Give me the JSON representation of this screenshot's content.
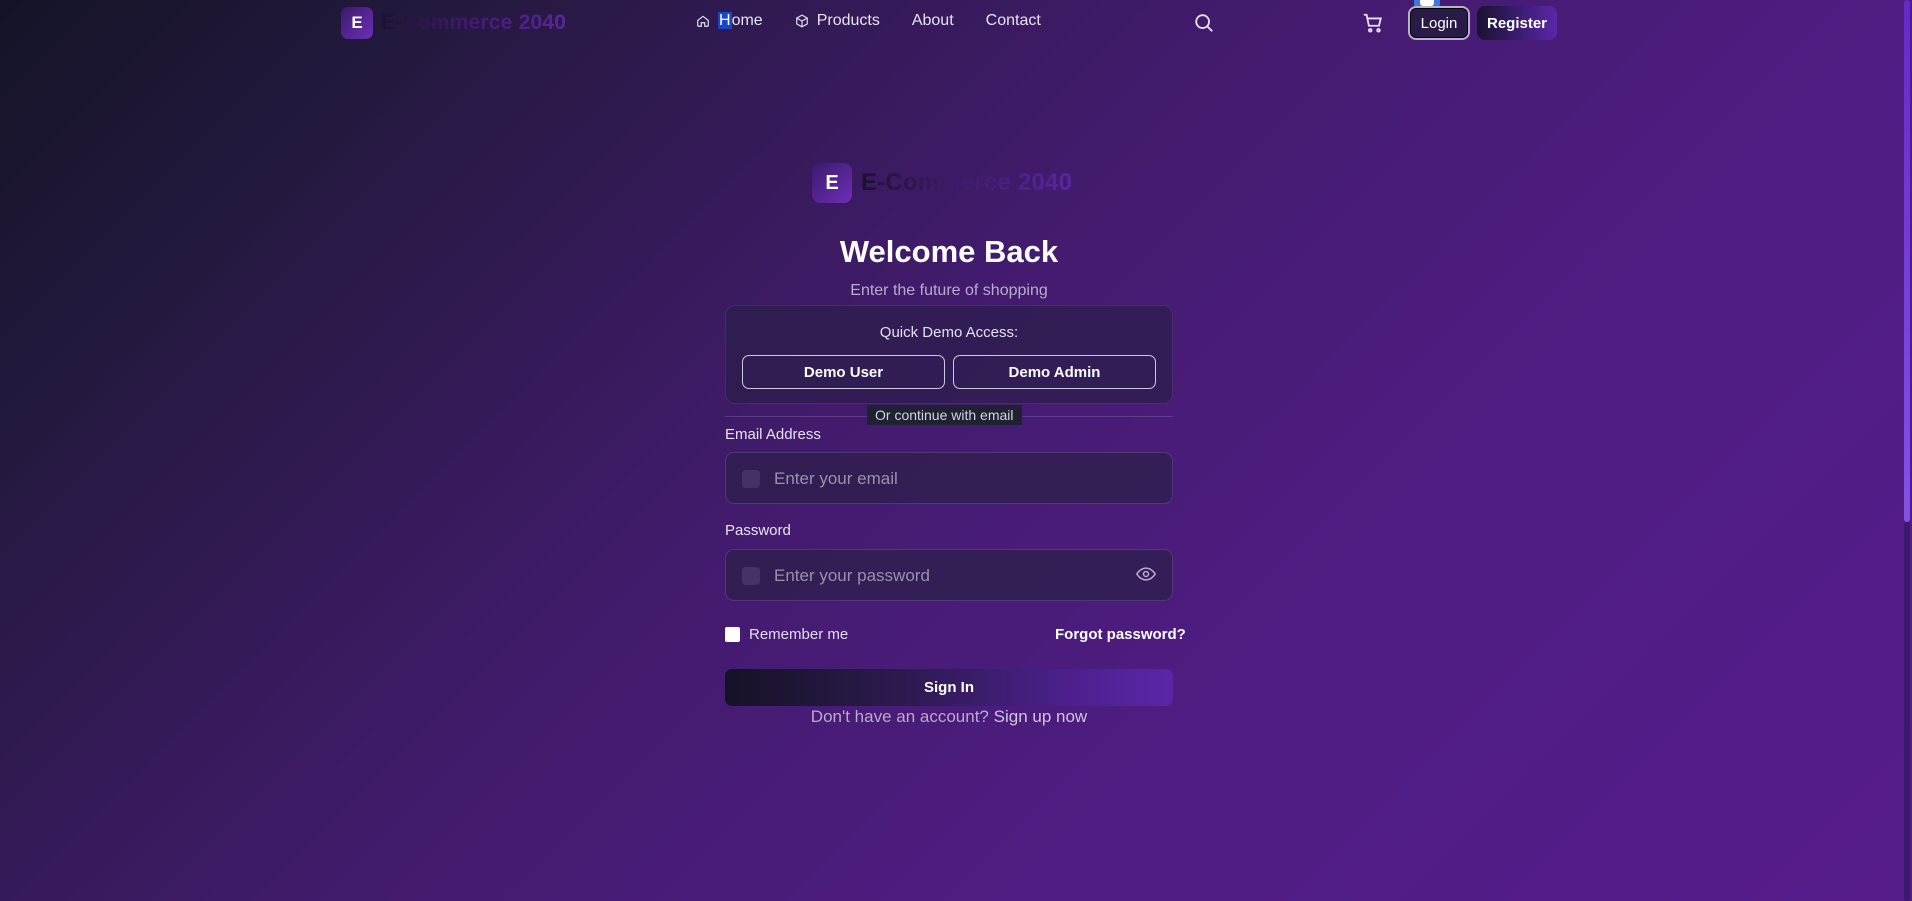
{
  "nav": {
    "logo_letter": "E",
    "brand": "E-Commerce 2040",
    "links": [
      {
        "label_prefix": "H",
        "label_rest": "ome"
      },
      {
        "label": "Products"
      },
      {
        "label": "About"
      },
      {
        "label": "Contact"
      }
    ],
    "login": "Login",
    "register": "Register"
  },
  "main": {
    "logo_letter": "E",
    "brand": "E-Commerce 2040",
    "title": "Welcome Back",
    "subtitle": "Enter the future of shopping",
    "demo": {
      "title": "Quick Demo Access:",
      "user": "Demo User",
      "admin": "Demo Admin"
    },
    "divider": "Or continue with email",
    "email": {
      "label": "Email Address",
      "placeholder": "Enter your email"
    },
    "password": {
      "label": "Password",
      "placeholder": "Enter your password"
    },
    "remember": "Remember me",
    "forgot": "Forgot password?",
    "signin": "Sign In",
    "signup_prompt": "Don't have an account?",
    "signup_link": "Sign up now"
  }
}
